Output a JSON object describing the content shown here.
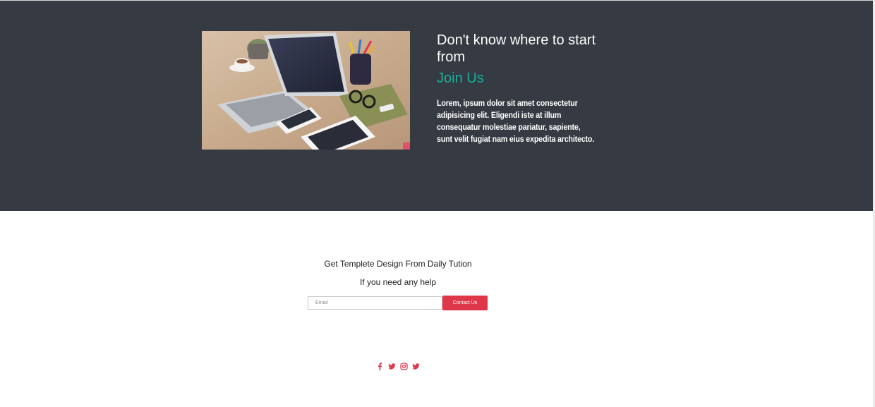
{
  "hero": {
    "title": "Don't know where to start from",
    "subtitle": "Join Us",
    "body": "Lorem, ipsum dolor sit amet consectetur adipisicing elit. Eligendi iste at illum consequatur molestiae pariatur, sapiente, sunt velit fugiat nam eius expedita architecto."
  },
  "cta": {
    "line1": "Get Templete Design From Daily Tution",
    "line2": "If you need any help"
  },
  "form": {
    "email_placeholder": "Email",
    "email_value": "",
    "button_label": "Contact Us"
  },
  "social": {
    "icons": [
      "facebook-icon",
      "twitter-icon",
      "instagram-icon",
      "twitter-icon"
    ]
  },
  "colors": {
    "hero_bg": "#353a43",
    "accent_teal": "#17b1a0",
    "button_red": "#e0364a",
    "social_red": "#e0364a"
  }
}
